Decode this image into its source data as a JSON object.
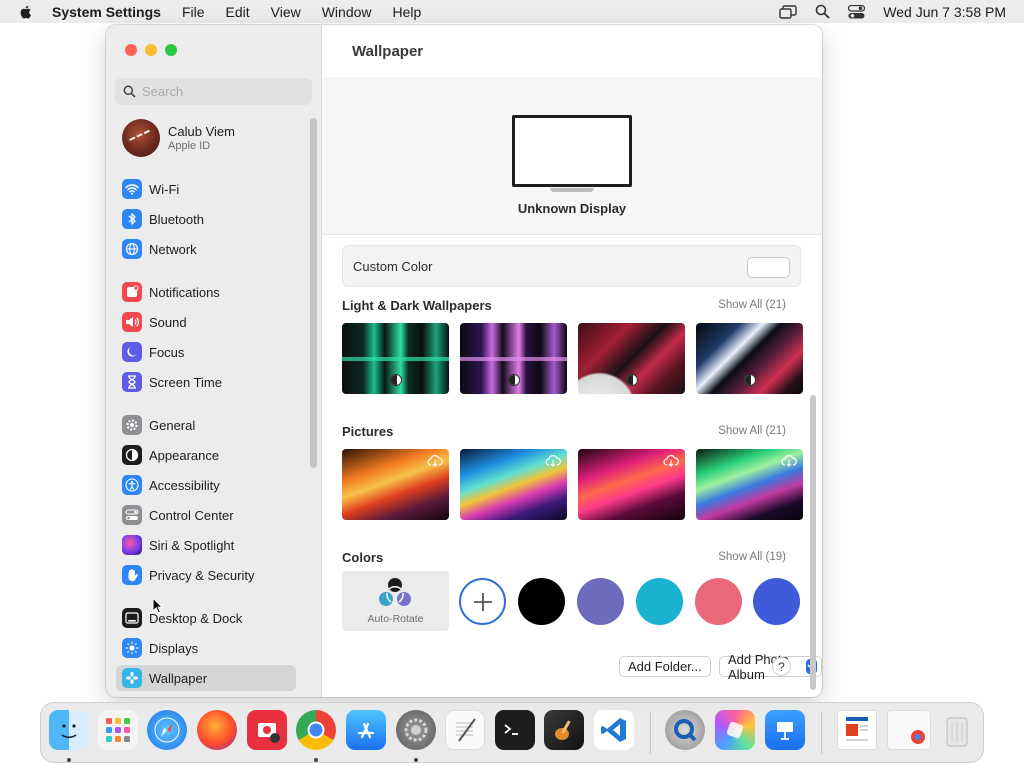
{
  "menubar": {
    "app_name": "System Settings",
    "menus": [
      "File",
      "Edit",
      "View",
      "Window",
      "Help"
    ],
    "clock": "Wed Jun 7  3:58 PM"
  },
  "window": {
    "search_placeholder": "Search",
    "user": {
      "name": "Calub Viem",
      "subtitle": "Apple ID"
    },
    "sidebar_items": [
      {
        "label": "Wi-Fi",
        "icon": "wifi-icon",
        "color": "#2f86f6"
      },
      {
        "label": "Bluetooth",
        "icon": "bluetooth-icon",
        "color": "#2f86f6"
      },
      {
        "label": "Network",
        "icon": "globe-icon",
        "color": "#2f86f6"
      },
      {
        "label": "Notifications",
        "icon": "bell-icon",
        "color": "#f4474e"
      },
      {
        "label": "Sound",
        "icon": "speaker-icon",
        "color": "#f4474e"
      },
      {
        "label": "Focus",
        "icon": "moon-icon",
        "color": "#5e5ce6"
      },
      {
        "label": "Screen Time",
        "icon": "hourglass-icon",
        "color": "#5e5ce6"
      },
      {
        "label": "General",
        "icon": "gear-icon",
        "color": "#8e8e93"
      },
      {
        "label": "Appearance",
        "icon": "appearance-icon",
        "color": "#1d1d1f"
      },
      {
        "label": "Accessibility",
        "icon": "accessibility-icon",
        "color": "#2f86f6"
      },
      {
        "label": "Control Center",
        "icon": "control-center-icon",
        "color": "#8e8e93"
      },
      {
        "label": "Siri & Spotlight",
        "icon": "siri-icon",
        "color": "#b03ad6"
      },
      {
        "label": "Privacy & Security",
        "icon": "hand-icon",
        "color": "#2f86f6"
      },
      {
        "label": "Desktop & Dock",
        "icon": "dock-icon",
        "color": "#1d1d1f"
      },
      {
        "label": "Displays",
        "icon": "sun-icon",
        "color": "#2f86f6"
      },
      {
        "label": "Wallpaper",
        "icon": "wallpaper-icon",
        "color": "#35b6e6"
      }
    ],
    "selected_item": "Wallpaper"
  },
  "main": {
    "title": "Wallpaper",
    "display_name": "Unknown Display",
    "custom_color_label": "Custom Color",
    "sections": {
      "light_dark": {
        "title": "Light & Dark Wallpapers",
        "show_all": "Show All (21)"
      },
      "pictures": {
        "title": "Pictures",
        "show_all": "Show All (21)"
      },
      "colors": {
        "title": "Colors",
        "show_all": "Show All (19)"
      }
    },
    "auto_rotate_label": "Auto-Rotate",
    "color_swatches": [
      "#000000",
      "#6c6bbd",
      "#1ab3cf",
      "#e9697a",
      "#3f5bd9"
    ],
    "buttons": {
      "add_folder": "Add Folder...",
      "add_photo_album": "Add Photo Album",
      "help": "?"
    }
  },
  "dock": {
    "apps": [
      "finder-icon",
      "launchpad-icon",
      "safari-icon",
      "firefox-icon",
      "photo-booth-icon",
      "chrome-icon",
      "app-store-icon",
      "system-settings-icon",
      "textedit-icon",
      "terminal-icon",
      "garageband-icon",
      "vscode-icon",
      "quicktime-icon",
      "affinity-icon",
      "keynote-icon",
      "document-icon",
      "window-icon",
      "trash-icon"
    ]
  }
}
